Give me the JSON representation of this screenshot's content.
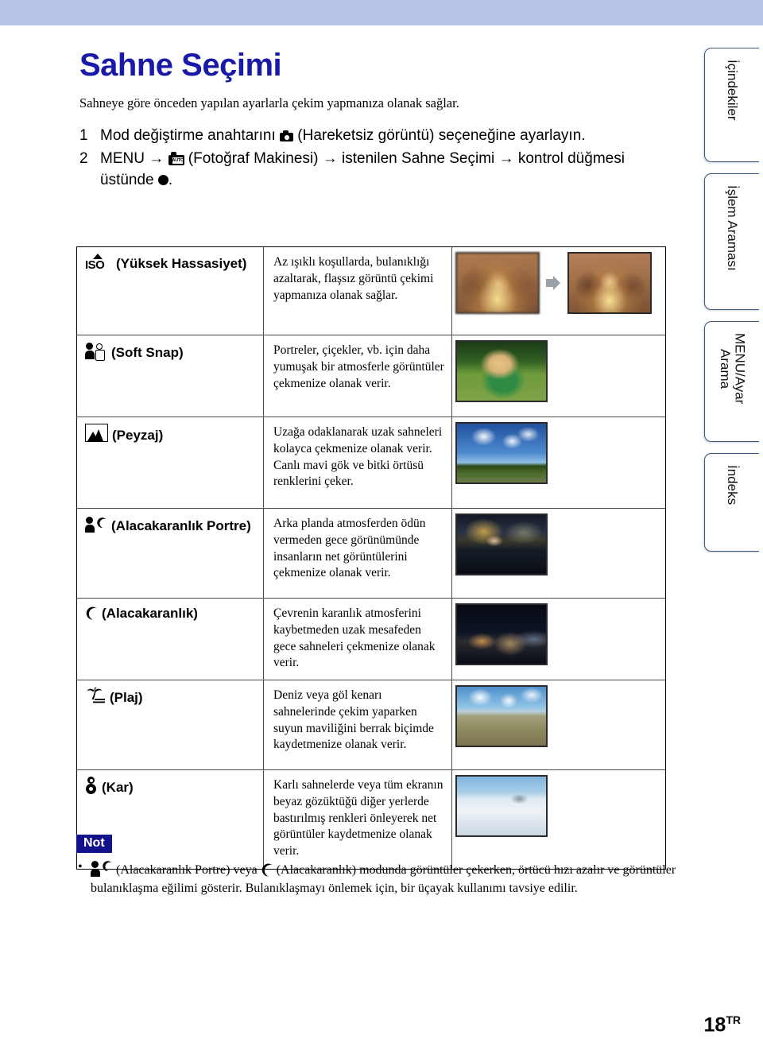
{
  "page": {
    "title": "Sahne Seçimi",
    "intro": "Sahneye göre önceden yapılan ayarlarla çekim yapmanıza olanak sağlar.",
    "page_number": "18",
    "page_number_suffix": "TR"
  },
  "steps": [
    {
      "num": "1",
      "text_before": "Mod değiştirme anahtarını",
      "icon": "still-image-camera-icon",
      "text_after": "(Hareketsiz görüntü) seçeneğine ayarlayın."
    },
    {
      "num": "2",
      "part1": "MENU",
      "arrow": "→",
      "icon": "camera-auto-icon",
      "part2": "(Fotoğraf Makinesi)",
      "part3": "istenilen Sahne Seçimi",
      "part4": "kontrol düğmesi üstünde",
      "part5": "."
    }
  ],
  "table": {
    "rows": [
      {
        "icon": "iso-high-sensitivity-icon",
        "label": "(Yüksek Hassasiyet)",
        "description": "Az ışıklı koşullarda, bulanıklığı azaltarak, flaşsız görüntü çekimi yapmanıza olanak sağlar.",
        "thumbnail": "before-after-blurry-to-sharp-party-photo"
      },
      {
        "icon": "soft-snap-people-icon",
        "label": "(Soft Snap)",
        "description": "Portreler, çiçekler, vb. için daha yumuşak bir atmosferle görüntüler çekmenize olanak verir.",
        "thumbnail": "child-in-green-shirt-on-grass"
      },
      {
        "icon": "landscape-mountains-icon",
        "label": "(Peyzaj)",
        "description": "Uzağa odaklanarak uzak sahneleri kolayca çekmenize olanak verir. Canlı mavi gök ve bitki örtüsü renklerini çeker.",
        "thumbnail": "blue-sky-field-landscape"
      },
      {
        "icon": "twilight-portrait-icon",
        "label": "(Alacakaranlık Portre)",
        "description": "Arka planda atmosferden ödün vermeden gece görünümünde insanların net görüntülerini çekmenize olanak verir.",
        "thumbnail": "woman-at-night-harbor"
      },
      {
        "icon": "twilight-moon-icon",
        "label": "(Alacakaranlık)",
        "description": "Çevrenin karanlık atmosferini kaybetmeden uzak mesafeden gece sahneleri çekmenize olanak verir.",
        "thumbnail": "rainbow-bridge-night-skyline"
      },
      {
        "icon": "beach-palm-icon",
        "label": "(Plaj)",
        "description": "Deniz veya göl kenarı sahnelerinde çekim yaparken suyun maviliğini berrak biçimde kaydetmenize olanak verir.",
        "thumbnail": "sea-shore-with-clouds"
      },
      {
        "icon": "snow-snowman-icon",
        "label": "(Kar)",
        "description": "Karlı sahnelerde veya tüm ekranın beyaz gözüktüğü diğer yerlerde bastırılmış renkleri önleyerek net görüntüler kaydetmenize olanak verir.",
        "thumbnail": "snowy-ski-slope-with-gondola"
      }
    ]
  },
  "note": {
    "label": "Not",
    "bullet": "•",
    "text_1": "(Alacakaranlık Portre) veya",
    "text_2": "(Alacakaranlık) modunda görüntüler çekerken, örtücü hızı azalır ve görüntüler bulanıklaşma eğilimi gösterir. Bulanıklaşmayı önlemek için, bir üçayak kullanımı tavsiye edilir."
  },
  "side_tabs": [
    {
      "label": "İçindekiler"
    },
    {
      "label": "İşlem Araması"
    },
    {
      "label": "MENU/Ayar\nArama"
    },
    {
      "label": "İndeks"
    }
  ],
  "colors": {
    "top_band": "#b9c5e8",
    "title": "#1a1aa8",
    "note_label_bg": "#12128c",
    "tab_border": "#3b5a86"
  }
}
